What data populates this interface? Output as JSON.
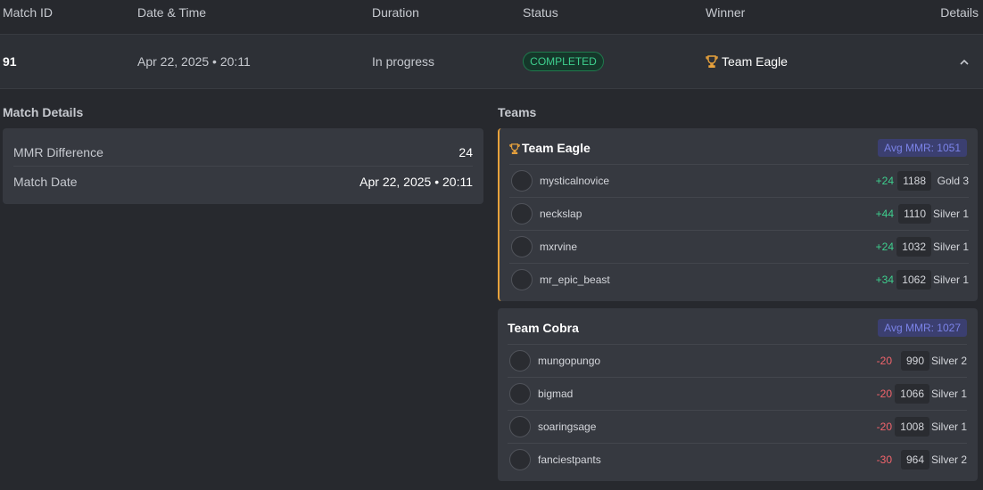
{
  "columns": {
    "match_id": "Match ID",
    "date_time": "Date & Time",
    "duration": "Duration",
    "status": "Status",
    "winner": "Winner",
    "details": "Details"
  },
  "match": {
    "id": "91",
    "date": "Apr 22, 2025 • 20:11",
    "duration": "In progress",
    "status": "COMPLETED",
    "winner": "Team Eagle"
  },
  "match_details": {
    "title": "Match Details",
    "mmr_difference_label": "MMR Difference",
    "mmr_difference_value": "24",
    "match_date_label": "Match Date",
    "match_date_value": "Apr 22, 2025 • 20:11"
  },
  "teams": {
    "title": "Teams",
    "list": [
      {
        "name": "Team Eagle",
        "avg_mmr": "Avg MMR: 1051",
        "players": [
          {
            "name": "mysticalnovice",
            "delta": "+24",
            "mmr": "1188",
            "rank": "Gold 3"
          },
          {
            "name": "neckslap",
            "delta": "+44",
            "mmr": "1110",
            "rank": "Silver 1"
          },
          {
            "name": "mxrvine",
            "delta": "+24",
            "mmr": "1032",
            "rank": "Silver 1"
          },
          {
            "name": "mr_epic_beast",
            "delta": "+34",
            "mmr": "1062",
            "rank": "Silver 1"
          }
        ]
      },
      {
        "name": "Team Cobra",
        "avg_mmr": "Avg MMR: 1027",
        "players": [
          {
            "name": "mungopungo",
            "delta": "-20",
            "mmr": "990",
            "rank": "Silver 2"
          },
          {
            "name": "bigmad",
            "delta": "-20",
            "mmr": "1066",
            "rank": "Silver 1"
          },
          {
            "name": "soaringsage",
            "delta": "-20",
            "mmr": "1008",
            "rank": "Silver 1"
          },
          {
            "name": "fanciestpants",
            "delta": "-30",
            "mmr": "964",
            "rank": "Silver 2"
          }
        ]
      }
    ]
  },
  "colors": {
    "win_accent": "#e8a23c",
    "status_green": "#3ecf8e",
    "loss_red": "#f2646c",
    "mmr_badge": "#7b83e8"
  }
}
